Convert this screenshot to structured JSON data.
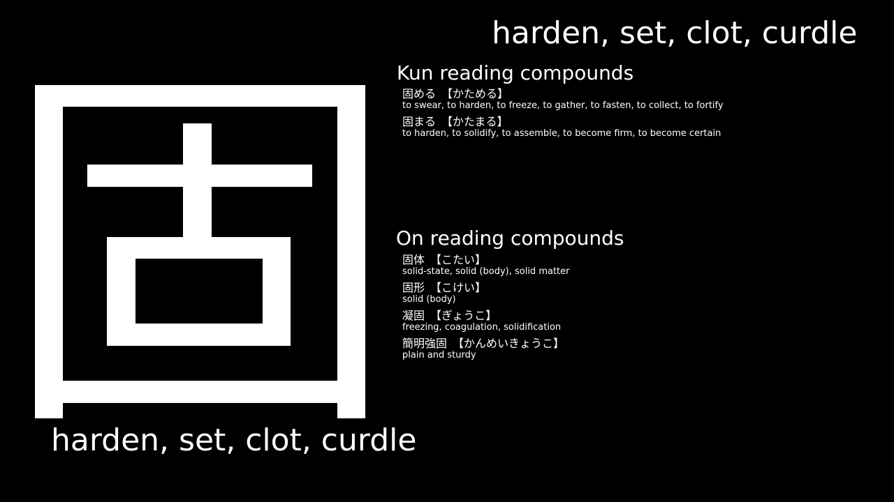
{
  "header": {
    "meaning": "harden, set, clot, curdle"
  },
  "kanji": {
    "character": "固",
    "icon": "kanji-glyph"
  },
  "footer": {
    "meaning": "harden, set, clot, curdle"
  },
  "kun": {
    "title": "Kun reading compounds",
    "items": [
      {
        "word": "固める",
        "reading": "【かためる】",
        "gloss": "to swear, to harden, to freeze, to gather, to fasten, to collect, to fortify"
      },
      {
        "word": "固まる",
        "reading": "【かたまる】",
        "gloss": "to harden, to solidify, to assemble, to become firm, to become certain"
      }
    ]
  },
  "on": {
    "title": "On reading compounds",
    "items": [
      {
        "word": "固体",
        "reading": "【こたい】",
        "gloss": "solid-state, solid (body), solid matter"
      },
      {
        "word": "固形",
        "reading": "【こけい】",
        "gloss": "solid (body)"
      },
      {
        "word": "凝固",
        "reading": "【ぎょうこ】",
        "gloss": "freezing, coagulation, solidification"
      },
      {
        "word": "簡明強固",
        "reading": "【かんめいきょうこ】",
        "gloss": "plain and sturdy"
      }
    ]
  },
  "colors": {
    "background": "#000000",
    "foreground": "#ffffff"
  }
}
